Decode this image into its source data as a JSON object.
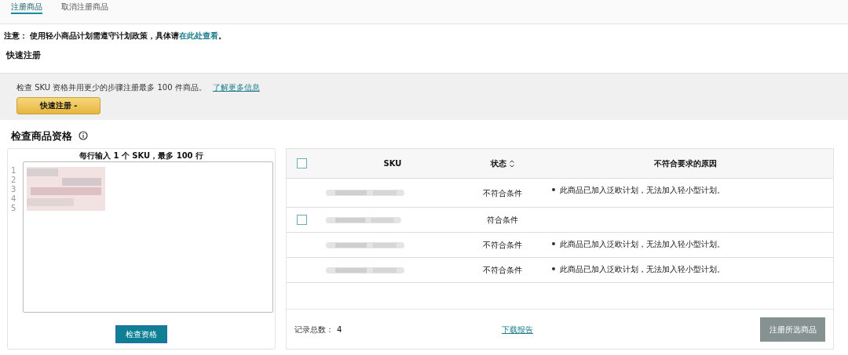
{
  "tabs": [
    {
      "label": "注册商品",
      "selected": true
    },
    {
      "label": "取消注册商品",
      "selected": false
    }
  ],
  "notice": {
    "text": "注意： 使用轻小商品计划需遵守计划政策，具体请",
    "link": "在此处查看",
    "end": "。"
  },
  "quick_register": {
    "title": "快速注册",
    "description": "检查 SKU 资格并用更少的步骤注册最多 100 件商品。",
    "link": "了解更多信息",
    "button": "快速注册 -"
  },
  "eligibility": {
    "title": "检查商品资格",
    "input_label": "每行输入 1 个 SKU，最多 100 行",
    "line_numbers": [
      "1",
      "2",
      "3",
      "4",
      "5"
    ],
    "check_button": "检查资格"
  },
  "table": {
    "select_all": {
      "checked": false
    },
    "columns": [
      "SKU",
      "状态",
      "不符合要求的原因"
    ],
    "rows": [
      {
        "checkable": false,
        "status": "不符合条件",
        "reason": "此商品已加入泛欧计划，无法加入轻小型计划。"
      },
      {
        "checkable": true,
        "checked": false,
        "status": "符合条件"
      },
      {
        "checkable": false,
        "status": "不符合条件",
        "reason": "此商品已加入泛欧计划，无法加入轻小型计划。"
      },
      {
        "checkable": false,
        "status": "不符合条件",
        "reason": "此商品已加入泛欧计划，无法加入轻小型计划。"
      }
    ],
    "total_label": "记录总数：",
    "total": "4",
    "download": "下载报告",
    "register_button": "注册所选商品",
    "register_disabled": true
  }
}
